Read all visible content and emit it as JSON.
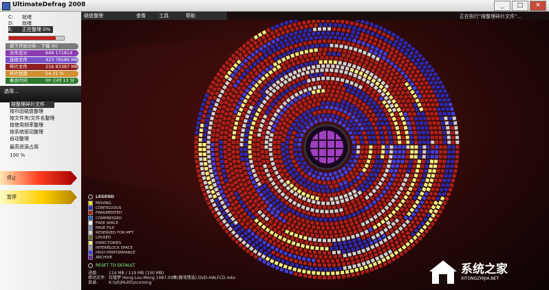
{
  "window": {
    "title": "UltimateDefrag 2008",
    "minimize": "_",
    "maximize": "□",
    "close": "✕"
  },
  "menu": {
    "items": [
      "磁盘整理",
      "查看",
      "工具",
      "帮助"
    ]
  },
  "status_top": "正在执行\"按整理碎片文件\"...",
  "drives": [
    {
      "letter": "C:",
      "label": "就绪"
    },
    {
      "letter": "D:",
      "label": "就绪"
    },
    {
      "letter": "E:",
      "label": "正在整理 0%"
    }
  ],
  "progress": {
    "value": 0.85
  },
  "stats": [
    {
      "label": "按下开始分析 - 下载 (K)",
      "value": "",
      "color": "#7a7a7a"
    },
    {
      "label": "文件总计",
      "value": "649   171814 MB",
      "color": "#8a3cb0"
    },
    {
      "label": "连续文件",
      "value": "423   78586 MB",
      "color": "#7a52c8"
    },
    {
      "label": "碎片文件",
      "value": "216   83387 MB",
      "color": "#8c1e1e"
    },
    {
      "label": "碎片程度",
      "value": "54.31 %",
      "color": "#d09030"
    },
    {
      "label": "剩余时间",
      "value": "00 小时 13 分",
      "color": "#2e7a2e"
    }
  ],
  "options": {
    "label": "选项...",
    "items": [
      "按整理碎片文件",
      "按巩固磁盘整理",
      "按文件夹/文件名整理",
      "按使用频率整理",
      "按系统驱动整理",
      "自动整理"
    ],
    "selected": 0
  },
  "resource": {
    "label": "最高资源占用",
    "value": "100 %"
  },
  "buttons": {
    "stop": "停止",
    "pause": "暂停"
  },
  "legend": {
    "title": "LEGEND",
    "items": [
      {
        "label": "MOVING",
        "color": "#e8e020"
      },
      {
        "label": "CONTIGUOUS",
        "color": "#2a2ab0"
      },
      {
        "label": "FRAGMENTED",
        "color": "#b02018"
      },
      {
        "label": "COMPRESSED",
        "color": "#2060c0"
      },
      {
        "label": "FREE SPACE",
        "color": "#ffffff"
      },
      {
        "label": "PAGE FILE",
        "color": "#7090c0"
      },
      {
        "label": "RESERVED FOR MFT",
        "color": "#d0d0d0"
      },
      {
        "label": "LOCKED",
        "color": "#6a6a20"
      },
      {
        "label": "DIRECTORIES",
        "color": "#f0f080"
      },
      {
        "label": "INTERBLOCK SPACE",
        "color": "#9a9ab0"
      },
      {
        "label": "HIGH PERFORMANCE",
        "color": "#4040e0"
      },
      {
        "label": "ARCHIVE",
        "color": "#7020a0"
      }
    ]
  },
  "reset": "RESET TO DEFAULT",
  "bottom": {
    "progress_label": "进度:",
    "progress_value": "114 MB / 119 MB  (150 MB)",
    "moving_label": "移动文件:",
    "moving_value": "红楼梦 Hong.Lou.Meng.1987.09集(搬弯情选).DVD-HALFCD.mkv",
    "dir_label": "目录:",
    "dir_value": "K:\\\\d\\\\Multi\\\\ncoming"
  },
  "watermark": {
    "cn": "系统之家",
    "en": "XITONGZHIJIA.NET"
  }
}
